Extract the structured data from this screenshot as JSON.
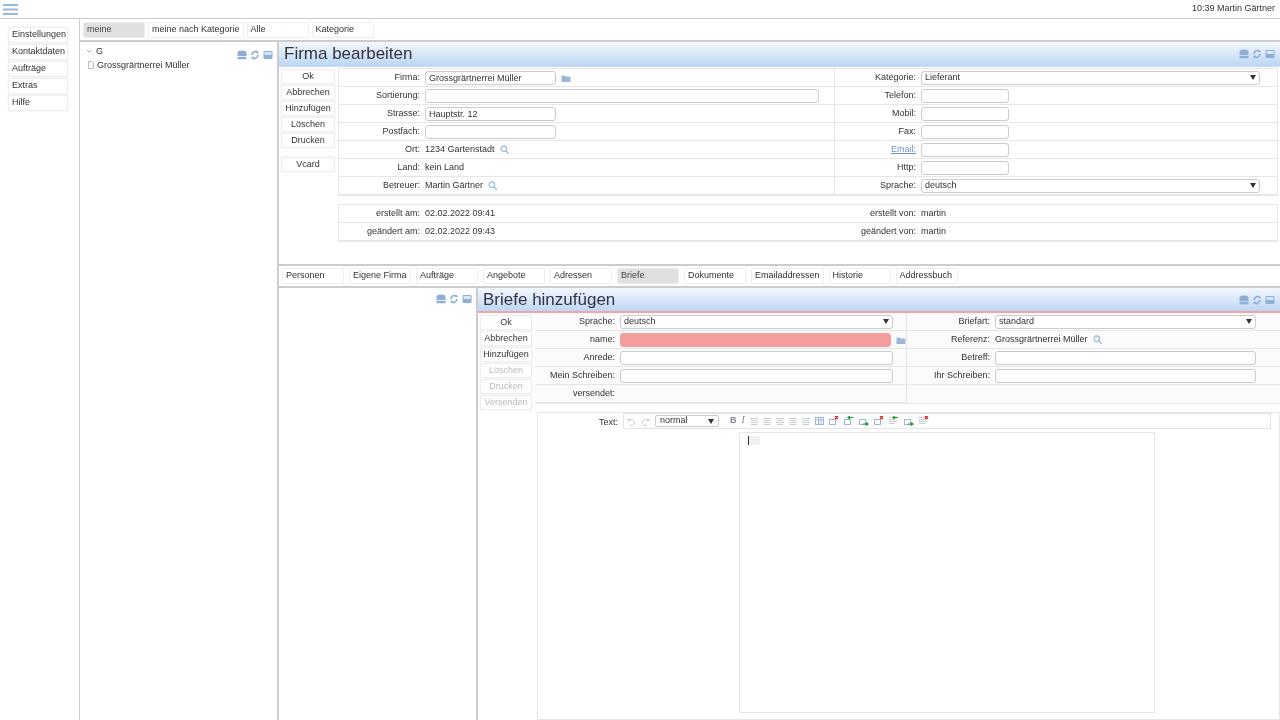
{
  "header": {
    "clock_user": "10:39 Martin Gärtner"
  },
  "sidebar": {
    "items": [
      "Einstellungen",
      "Kontaktdaten",
      "Aufträge",
      "Extras",
      "Hilfe"
    ]
  },
  "filter_tabs": [
    {
      "label": "meine",
      "selected": true
    },
    {
      "label": "meine nach Kategorie",
      "selected": false
    },
    {
      "label": "Alle",
      "selected": false
    },
    {
      "label": "Kategorie",
      "selected": false
    }
  ],
  "tree": [
    {
      "label": "G",
      "expanded": true,
      "children": [
        {
          "label": "Grossgrärtnerrei Müller"
        }
      ]
    }
  ],
  "company_form": {
    "title": "Firma bearbeiten",
    "buttons": [
      {
        "label": "Ok",
        "disabled": false
      },
      {
        "label": "Abbrechen",
        "disabled": false
      },
      {
        "label": "Hinzufügen",
        "disabled": false
      },
      {
        "label": "Löschen",
        "disabled": false
      },
      {
        "label": "Drucken",
        "disabled": false
      },
      {
        "label": "Vcard",
        "disabled": false
      }
    ],
    "left_fields": [
      {
        "label": "Firma:",
        "kind": "picker",
        "value": "Grossgrärtnerrei Müller",
        "invalid": false
      },
      {
        "label": "Sortierung:",
        "kind": "wideinput"
      },
      {
        "label": "Strasse:",
        "kind": "input",
        "value": "Hauptstr. 12"
      },
      {
        "label": "Postfach:",
        "kind": "input"
      },
      {
        "label": "Ort:",
        "kind": "lookup",
        "value": "1234 Gartenstadt"
      },
      {
        "label": "Land:",
        "kind": "text",
        "value": "kein Land"
      },
      {
        "label": "Betreuer:",
        "kind": "lookup",
        "value": "Martin Gärtner"
      }
    ],
    "right_fields": [
      {
        "label": "Kategorie:",
        "kind": "select",
        "value": "Lieferant"
      },
      {
        "label": "Telefon:",
        "kind": "input"
      },
      {
        "label": "Mobil:",
        "kind": "input"
      },
      {
        "label": "Fax:",
        "kind": "input"
      },
      {
        "label": "Email:",
        "kind": "input",
        "link": true
      },
      {
        "label": "Http:",
        "kind": "input"
      },
      {
        "label": "Sprache:",
        "kind": "select",
        "value": "deutsch"
      }
    ],
    "meta_left": [
      {
        "label": "erstellt am:",
        "value": "02.02.2022 09:41"
      },
      {
        "label": "geändert am:",
        "value": "02.02.2022 09:43"
      }
    ],
    "meta_right": [
      {
        "label": "erstellt von:",
        "value": "martin"
      },
      {
        "label": "geändert von:",
        "value": "martin"
      }
    ]
  },
  "sub_tabs": [
    {
      "label": "Personen",
      "selected": false
    },
    {
      "label": "Eigene Firma",
      "selected": false
    },
    {
      "label": "Aufträge",
      "selected": false
    },
    {
      "label": "Angebote",
      "selected": false
    },
    {
      "label": "Adressen",
      "selected": false
    },
    {
      "label": "Briefe",
      "selected": true
    },
    {
      "label": "Dokumente",
      "selected": false
    },
    {
      "label": "Emailaddressen",
      "selected": false
    },
    {
      "label": "Historie",
      "selected": false
    },
    {
      "label": "Addressbuch",
      "selected": false
    }
  ],
  "letter_form": {
    "title": "Briefe hinzufügen",
    "buttons": [
      {
        "label": "Ok",
        "disabled": false
      },
      {
        "label": "Abbrechen",
        "disabled": false
      },
      {
        "label": "Hinzufügen",
        "disabled": false
      },
      {
        "label": "Löschen",
        "disabled": true
      },
      {
        "label": "Drucken",
        "disabled": true
      },
      {
        "label": "Versenden",
        "disabled": true
      }
    ],
    "left_fields": [
      {
        "label": "Sprache:",
        "kind": "select",
        "value": "deutsch"
      },
      {
        "label": "name:",
        "kind": "picker",
        "invalid": true
      },
      {
        "label": "Anrede:",
        "kind": "wideinput"
      },
      {
        "label": "Mein Schreiben:",
        "kind": "wideinput"
      },
      {
        "label": "versendet:",
        "kind": "text"
      }
    ],
    "right_fields": [
      {
        "label": "Briefart:",
        "kind": "select",
        "value": "standard"
      },
      {
        "label": "Referenz:",
        "kind": "lookup",
        "value": "Grossgrärtnerrei Müller"
      },
      {
        "label": "Betreff:",
        "kind": "wideinput"
      },
      {
        "label": "Ihr Schreiben:",
        "kind": "wideinput"
      }
    ],
    "editor": {
      "label": "Text:",
      "format": "normal",
      "bold": "B",
      "italic": "I"
    }
  }
}
